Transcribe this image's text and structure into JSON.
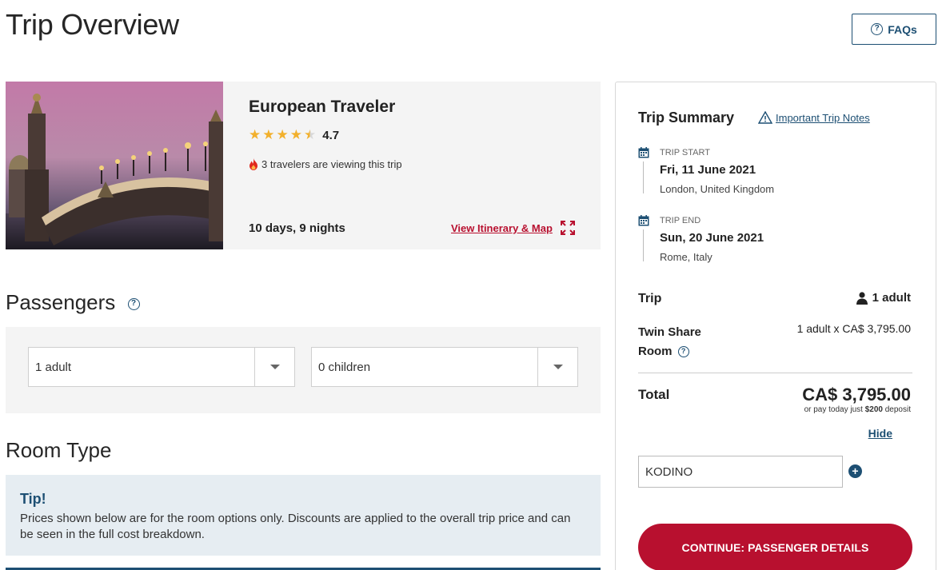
{
  "page": {
    "title": "Trip Overview",
    "faq_label": "FAQs"
  },
  "trip": {
    "name": "European Traveler",
    "rating": "4.7",
    "stars_filled": 4.5,
    "viewing_text": "3 travelers are viewing this trip",
    "duration": "10 days, 9 nights",
    "itinerary_link": "View Itinerary & Map"
  },
  "passengers": {
    "heading": "Passengers",
    "adults_selected": "1 adult",
    "children_selected": "0 children"
  },
  "room_type": {
    "heading": "Room Type",
    "tip_title": "Tip!",
    "tip_text": "Prices shown below are for the room options only. Discounts are applied to the overall trip price and can be seen in the full cost breakdown."
  },
  "summary": {
    "title": "Trip Summary",
    "notes_link": "Important Trip Notes",
    "start": {
      "label": "TRIP START",
      "date": "Fri, 11 June 2021",
      "place": "London, United Kingdom"
    },
    "end": {
      "label": "TRIP END",
      "date": "Sun, 20 June 2021",
      "place": "Rome, Italy"
    },
    "trip_label": "Trip",
    "travelers": "1 adult",
    "room_label_1": "Twin Share",
    "room_label_2": "Room",
    "room_price": "1 adult x CA$ 3,795.00",
    "total_label": "Total",
    "total_value": "CA$ 3,795.00",
    "deposit_prefix": "or pay today just ",
    "deposit_amount": "$200",
    "deposit_suffix": " deposit",
    "hide_label": "Hide",
    "promo_value": "KODINO",
    "continue_label": "CONTINUE: PASSENGER DETAILS"
  },
  "colors": {
    "brand_red": "#b8102f",
    "brand_blue": "#1d4f73",
    "star": "#f2b02c"
  }
}
